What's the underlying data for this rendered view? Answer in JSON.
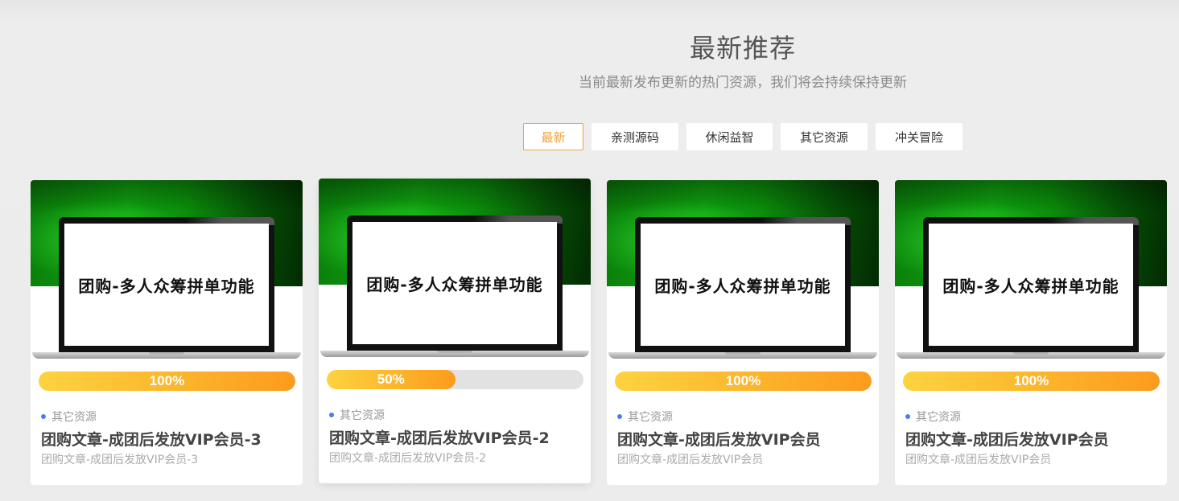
{
  "section": {
    "title": "最新推荐",
    "subtitle": "当前最新发布更新的热门资源，我们将会持续保持更新"
  },
  "tabs": [
    {
      "label": "最新",
      "active": true
    },
    {
      "label": "亲测源码",
      "active": false
    },
    {
      "label": "休闲益智",
      "active": false
    },
    {
      "label": "其它资源",
      "active": false
    },
    {
      "label": "冲关冒险",
      "active": false
    }
  ],
  "cards": [
    {
      "thumb_text": "团购-多人众筹拼单功能",
      "progress_percent": 100,
      "progress_label": "100%",
      "category": "其它资源",
      "title": "团购文章-成团后发放VIP会员-3",
      "desc": "团购文章-成团后发放VIP会员-3"
    },
    {
      "thumb_text": "团购-多人众筹拼单功能",
      "progress_percent": 50,
      "progress_label": "50%",
      "category": "其它资源",
      "title": "团购文章-成团后发放VIP会员-2",
      "desc": "团购文章-成团后发放VIP会员-2"
    },
    {
      "thumb_text": "团购-多人众筹拼单功能",
      "progress_percent": 100,
      "progress_label": "100%",
      "category": "其它资源",
      "title": "团购文章-成团后发放VIP会员",
      "desc": "团购文章-成团后发放VIP会员"
    },
    {
      "thumb_text": "团购-多人众筹拼单功能",
      "progress_percent": 100,
      "progress_label": "100%",
      "category": "其它资源",
      "title": "团购文章-成团后发放VIP会员",
      "desc": "团购文章-成团后发放VIP会员"
    }
  ],
  "colors": {
    "accent": "#f0a33a",
    "category_dot": "#4d7ee8",
    "progress_start": "#fdd33e",
    "progress_end": "#fc9b1d"
  }
}
